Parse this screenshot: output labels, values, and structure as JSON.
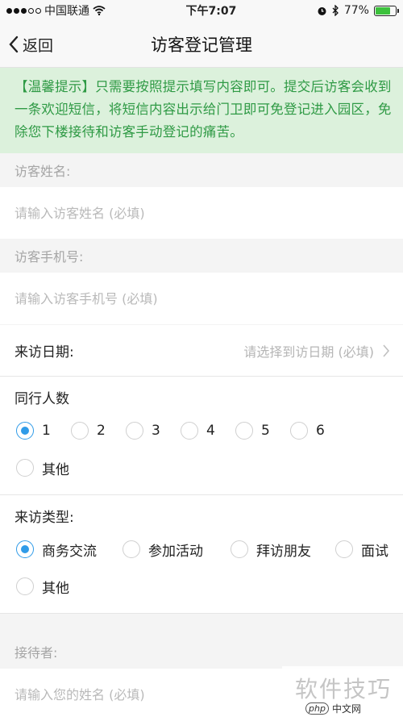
{
  "status": {
    "carrier": "中国联通",
    "time": "下午7:07",
    "battery": "77%",
    "battery_level": 0.77
  },
  "nav": {
    "back_label": "返回",
    "title": "访客登记管理"
  },
  "tip": "【温馨提示】只需要按照提示填写内容即可。提交后访客会收到一条欢迎短信，将短信内容出示给门卫即可免登记进入园区，免除您下楼接待和访客手动登记的痛苦。",
  "form": {
    "visitor_name": {
      "label": "访客姓名:",
      "placeholder": "请输入访客姓名 (必填)"
    },
    "visitor_phone": {
      "label": "访客手机号:",
      "placeholder": "请输入访客手机号 (必填)"
    },
    "visit_date": {
      "label": "来访日期:",
      "placeholder": "请选择到访日期 (必填)"
    },
    "companions": {
      "label": "同行人数",
      "options": [
        "1",
        "2",
        "3",
        "4",
        "5",
        "6",
        "其他"
      ],
      "selected": "1"
    },
    "visit_type": {
      "label": "来访类型:",
      "options": [
        "商务交流",
        "参加活动",
        "拜访朋友",
        "面试",
        "其他"
      ],
      "selected": "商务交流"
    },
    "host": {
      "label": "接待者:",
      "placeholder": "请输入您的姓名 (必填)"
    }
  },
  "watermark": {
    "text": "软件技巧",
    "logo": "php",
    "logo_text": "中文网"
  },
  "colors": {
    "tip_bg": "#dcf1dc",
    "tip_text": "#2f9a45",
    "radio_selected": "#2f9be8"
  }
}
